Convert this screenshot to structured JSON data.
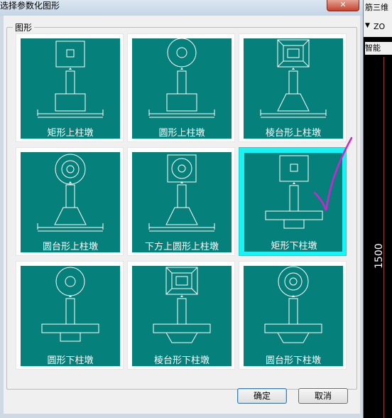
{
  "window": {
    "title": "选择参数化图形",
    "close_symbol": "✕"
  },
  "group": {
    "label": "图形"
  },
  "tiles": [
    {
      "label": "矩形上柱墩",
      "selected": false
    },
    {
      "label": "圆形上柱墩",
      "selected": false
    },
    {
      "label": "棱台形上柱墩",
      "selected": false
    },
    {
      "label": "圆台形上柱墩",
      "selected": false
    },
    {
      "label": "下方上圆形上柱墩",
      "selected": false
    },
    {
      "label": "矩形下柱墩",
      "selected": true
    },
    {
      "label": "圆形下柱墩",
      "selected": false
    },
    {
      "label": "棱台形下柱墩",
      "selected": false
    },
    {
      "label": "圆台形下柱墩",
      "selected": false
    }
  ],
  "buttons": {
    "ok": "确定",
    "cancel": "取消"
  },
  "background_app": {
    "text_top": "筋三维",
    "dropdown": "ZO",
    "text_smart": "智能",
    "dimension": "1500"
  },
  "colors": {
    "panel": "#05807a",
    "selection": "#18f4f4",
    "annotation": "#d61fd6"
  }
}
